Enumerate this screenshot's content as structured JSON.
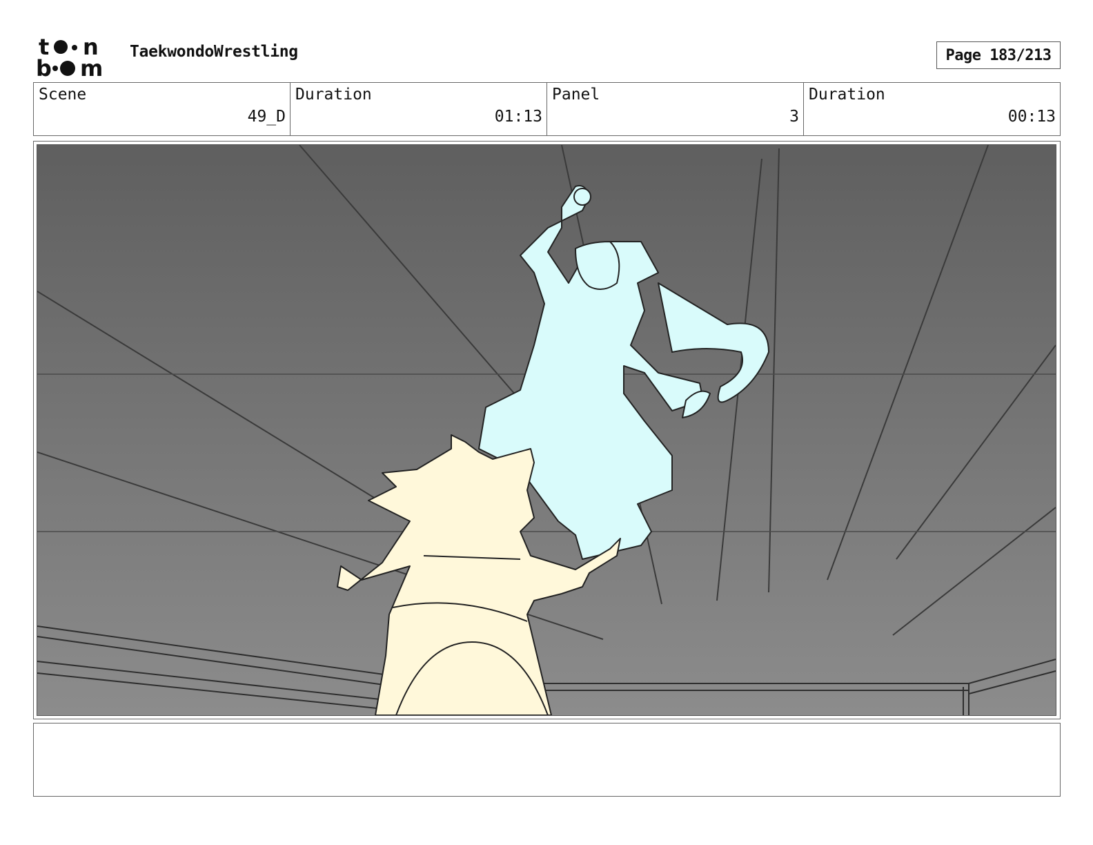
{
  "header": {
    "logo_alt": "toon boom",
    "project_title": "TaekwondoWrestling",
    "page_indicator": "Page 183/213"
  },
  "info_bar": {
    "scene_label": "Scene",
    "scene_value": "49_D",
    "scene_duration_label": "Duration",
    "scene_duration_value": "01:13",
    "panel_label": "Panel",
    "panel_value": "3",
    "panel_duration_label": "Duration",
    "panel_duration_value": "00:13"
  },
  "panel": {
    "colors": {
      "background_top": "#5f5f5f",
      "background_bottom": "#8c8c8c",
      "blue_character": "#d9fbfb",
      "yellow_character": "#fff8da",
      "line": "#222222"
    }
  },
  "notes": {
    "text": ""
  }
}
